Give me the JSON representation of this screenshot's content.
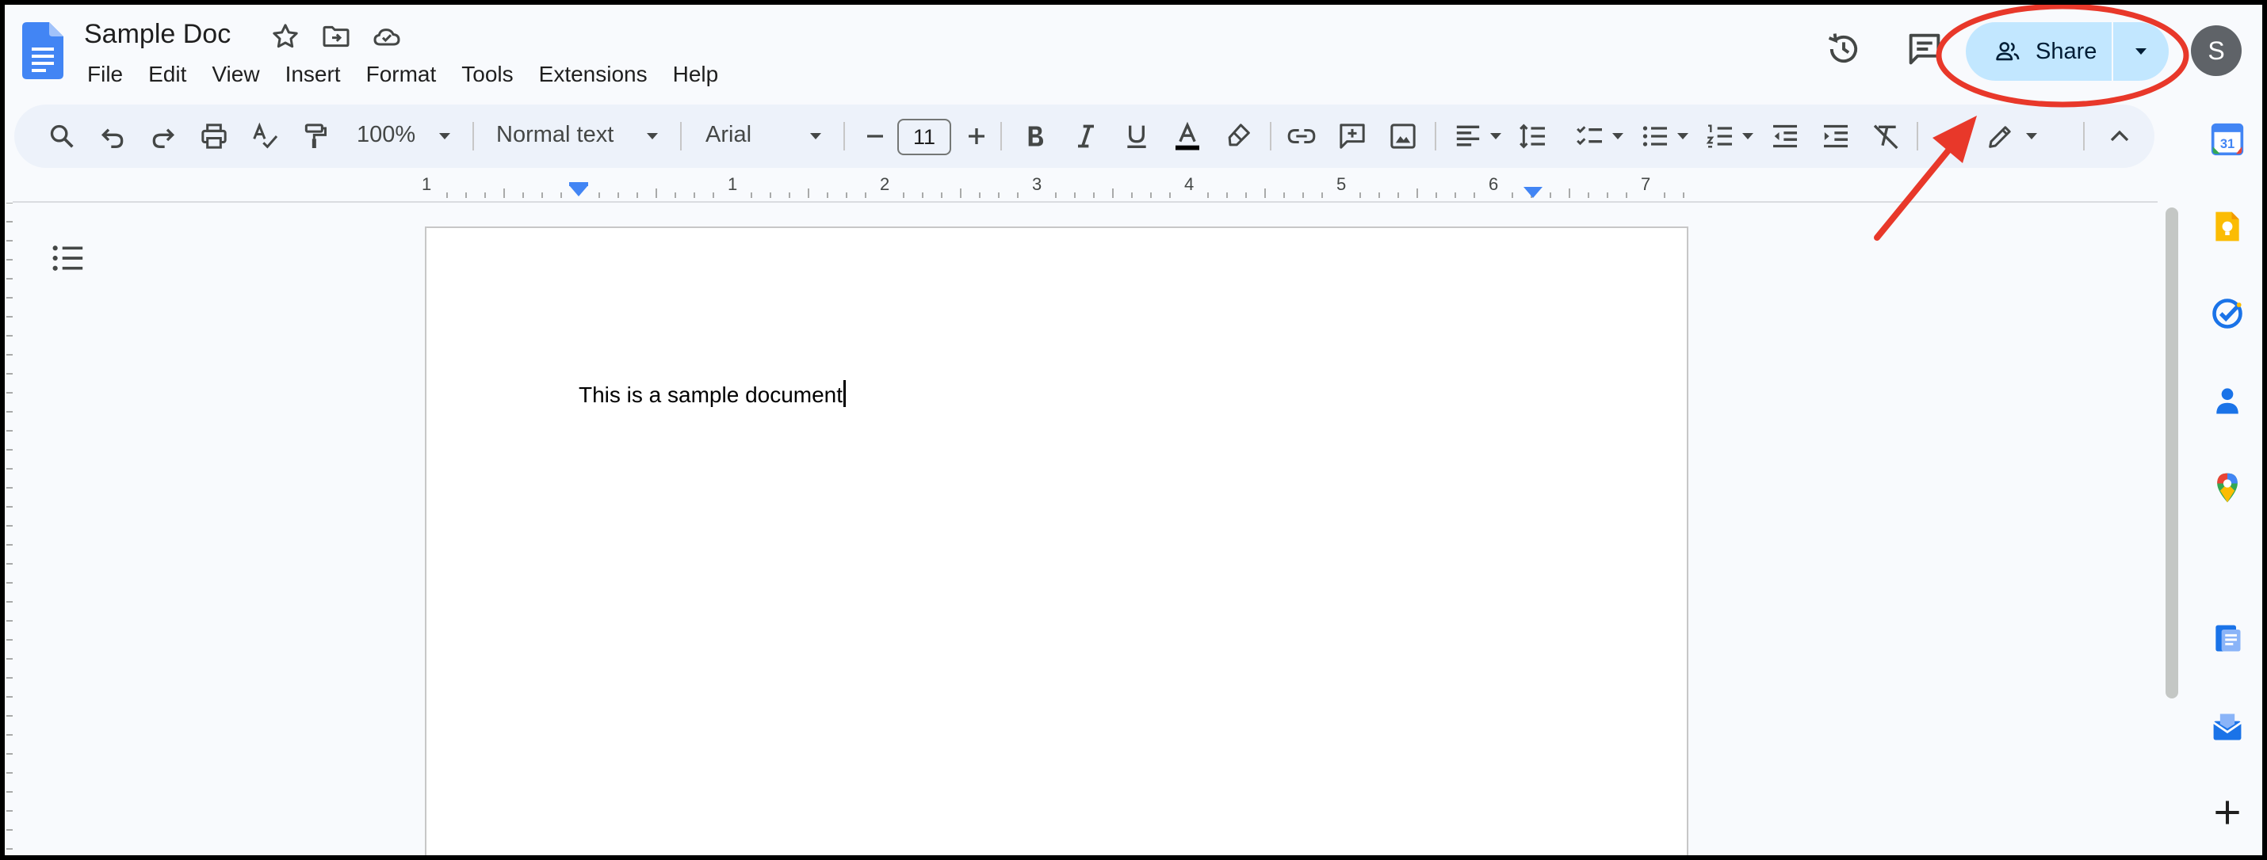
{
  "document": {
    "title": "Sample Doc",
    "body_text": "This is a sample document"
  },
  "menu": {
    "items": [
      "File",
      "Edit",
      "View",
      "Insert",
      "Format",
      "Tools",
      "Extensions",
      "Help"
    ]
  },
  "header": {
    "share_label": "Share",
    "avatar_initial": "S"
  },
  "toolbar": {
    "zoom": "100%",
    "paragraph_style": "Normal text",
    "font_family": "Arial",
    "font_size": "11"
  },
  "ruler": {
    "labels": [
      "1",
      "1",
      "2",
      "3",
      "4",
      "5",
      "6",
      "7"
    ]
  },
  "colors": {
    "accent_blue": "#1a73e8",
    "share_bg": "#c2e7ff",
    "annotation_red": "#e8382a",
    "background": "#f8fafd"
  },
  "icons": {
    "header": [
      "docs-logo-icon",
      "star-icon",
      "move-to-folder-icon",
      "cloud-saved-icon",
      "version-history-icon",
      "comments-icon",
      "people-icon",
      "caret-down-icon"
    ],
    "side_panel": [
      "calendar-icon",
      "keep-icon",
      "tasks-icon",
      "contacts-icon",
      "maps-icon",
      "docs-addon-icon",
      "mail-addon-icon",
      "plus-icon"
    ]
  },
  "side_panel": {
    "calendar_day": "31"
  }
}
